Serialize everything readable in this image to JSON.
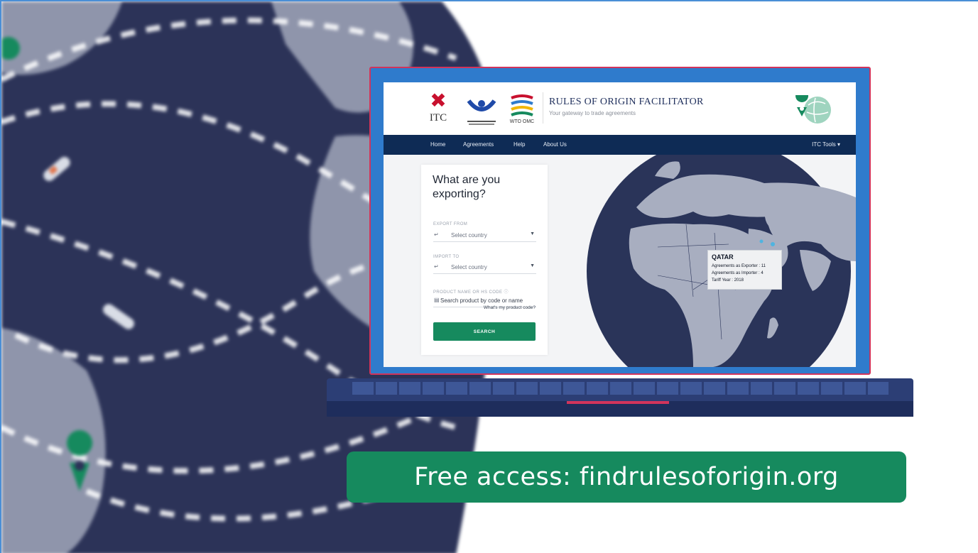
{
  "banner": {
    "text": "Free access: findrulesoforigin.org"
  },
  "site": {
    "logos": {
      "itc_text": "ITC",
      "wto_text": "WTO OMC",
      "wco_text": "World Customs Organization"
    },
    "title": "RULES OF ORIGIN FACILITATOR",
    "tagline": "Your gateway to trade agreements"
  },
  "nav": {
    "items": [
      "Home",
      "Agreements",
      "Help",
      "About Us"
    ],
    "tools": "ITC Tools"
  },
  "form": {
    "title": "What are you exporting?",
    "export_from_label": "EXPORT FROM",
    "export_from_placeholder": "Select country",
    "import_to_label": "IMPORT TO",
    "import_to_placeholder": "Select country",
    "product_label": "PRODUCT NAME OR HS CODE",
    "product_placeholder": "Search product by code or name",
    "help_link": "What's my product code?",
    "search_button": "SEARCH"
  },
  "tooltip": {
    "country": "QATAR",
    "lines": [
      "Agreements as Exporter : 11",
      "Agreements as Importer : 4",
      "Tariff Year : 2018"
    ]
  },
  "icons": {
    "location_pin": "map-pin-icon",
    "globe": "globe-icon",
    "dropdown": "chevron-down-icon",
    "info": "info-icon",
    "product": "barcode-icon"
  },
  "colors": {
    "accent_green": "#168a5e",
    "nav_blue": "#0e2b55",
    "laptop_blue": "#2f7bcc",
    "laptop_border": "#d1345b",
    "globe_dark": "#2a3459"
  }
}
